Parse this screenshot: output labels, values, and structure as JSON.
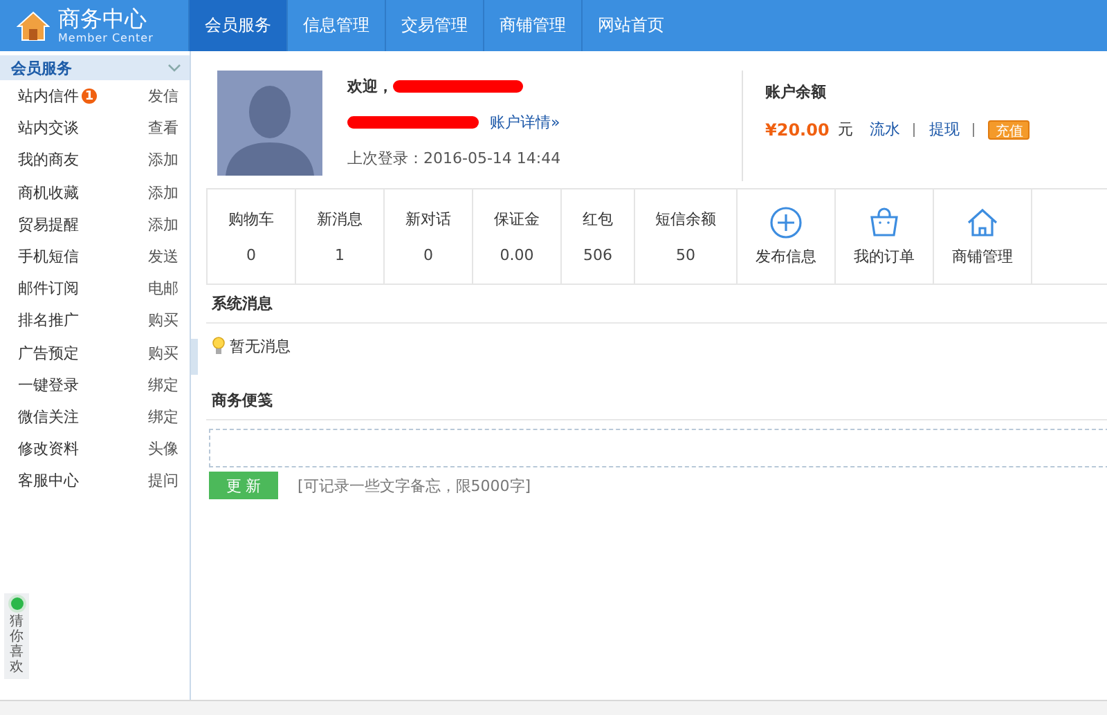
{
  "header": {
    "title": "商务中心",
    "subtitle": "Member Center",
    "tabs": [
      {
        "label": "会员服务",
        "selected": true
      },
      {
        "label": "信息管理",
        "selected": false
      },
      {
        "label": "交易管理",
        "selected": false
      },
      {
        "label": "商铺管理",
        "selected": false
      },
      {
        "label": "网站首页",
        "selected": false
      }
    ]
  },
  "sidebar": {
    "title": "会员服务",
    "expanded": true,
    "items": [
      {
        "label": "站内信件",
        "badge": "1",
        "action": "发信"
      },
      {
        "label": "站内交谈",
        "action": "查看"
      },
      {
        "label": "我的商友",
        "action": "添加"
      },
      {
        "label": "商机收藏",
        "action": "添加"
      },
      {
        "label": "贸易提醒",
        "action": "添加"
      },
      {
        "label": "手机短信",
        "action": "发送"
      },
      {
        "label": "邮件订阅",
        "action": "电邮"
      },
      {
        "label": "排名推广",
        "action": "购买"
      },
      {
        "label": "广告预定",
        "action": "购买"
      },
      {
        "label": "一键登录",
        "action": "绑定"
      },
      {
        "label": "微信关注",
        "action": "绑定"
      },
      {
        "label": "修改资料",
        "action": "头像"
      },
      {
        "label": "客服中心",
        "action": "提问"
      }
    ],
    "side_widget": "猜你喜欢"
  },
  "profile": {
    "welcome": "欢迎，",
    "details_link": "账户详情»",
    "last_login": "上次登录：2016-05-14 14:44"
  },
  "balance": {
    "title": "账户余额",
    "amount": "¥20.00",
    "unit": "元",
    "links": [
      "流水",
      "提现"
    ],
    "recharge": "充值"
  },
  "stats": [
    {
      "kind": "stat",
      "label": "购物车",
      "value": "0"
    },
    {
      "kind": "stat",
      "label": "新消息",
      "value": "1"
    },
    {
      "kind": "stat",
      "label": "新对话",
      "value": "0"
    },
    {
      "kind": "stat",
      "label": "保证金",
      "value": "0.00"
    },
    {
      "kind": "stat",
      "label": "红包",
      "value": "506"
    },
    {
      "kind": "stat",
      "label": "短信余额",
      "value": "50"
    },
    {
      "kind": "publish",
      "label": "发布信息"
    },
    {
      "kind": "orders",
      "label": "我的订单"
    },
    {
      "kind": "store",
      "label": "商铺管理"
    }
  ],
  "system_messages": {
    "title": "系统消息",
    "empty": "暂无消息"
  },
  "memo": {
    "title": "商务便笺",
    "button": "更 新",
    "hint": "[可记录一些文字备忘，限5000字]"
  }
}
